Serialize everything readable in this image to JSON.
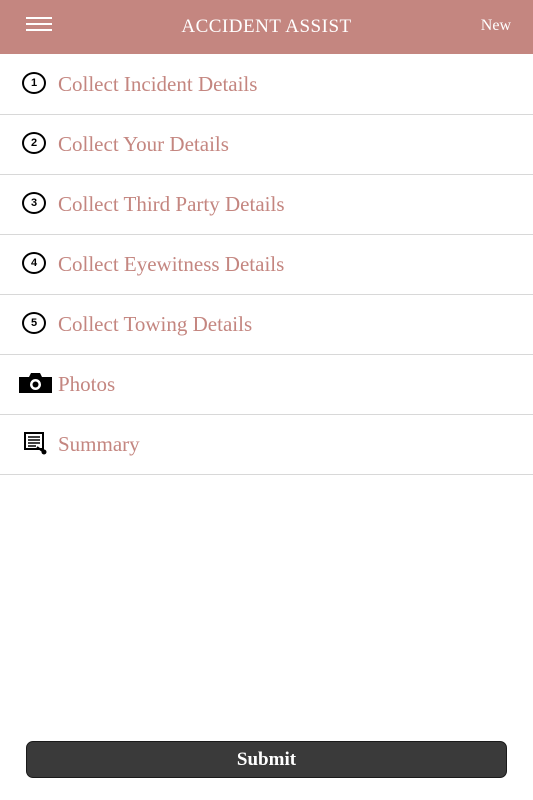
{
  "header": {
    "title": "ACCIDENT ASSIST",
    "new_label": "New"
  },
  "menu": {
    "items": [
      {
        "badge": "1",
        "label": "Collect Incident Details"
      },
      {
        "badge": "2",
        "label": "Collect Your Details"
      },
      {
        "badge": "3",
        "label": "Collect Third Party Details"
      },
      {
        "badge": "4",
        "label": "Collect Eyewitness Details"
      },
      {
        "badge": "5",
        "label": "Collect Towing Details"
      },
      {
        "icon": "camera-icon",
        "label": "Photos"
      },
      {
        "icon": "summary-document-icon",
        "label": "Summary"
      }
    ]
  },
  "footer": {
    "submit_label": "Submit"
  },
  "colors": {
    "header_bg": "#c48680",
    "label_text": "#c48680",
    "submit_bg": "#3a3a3a"
  }
}
